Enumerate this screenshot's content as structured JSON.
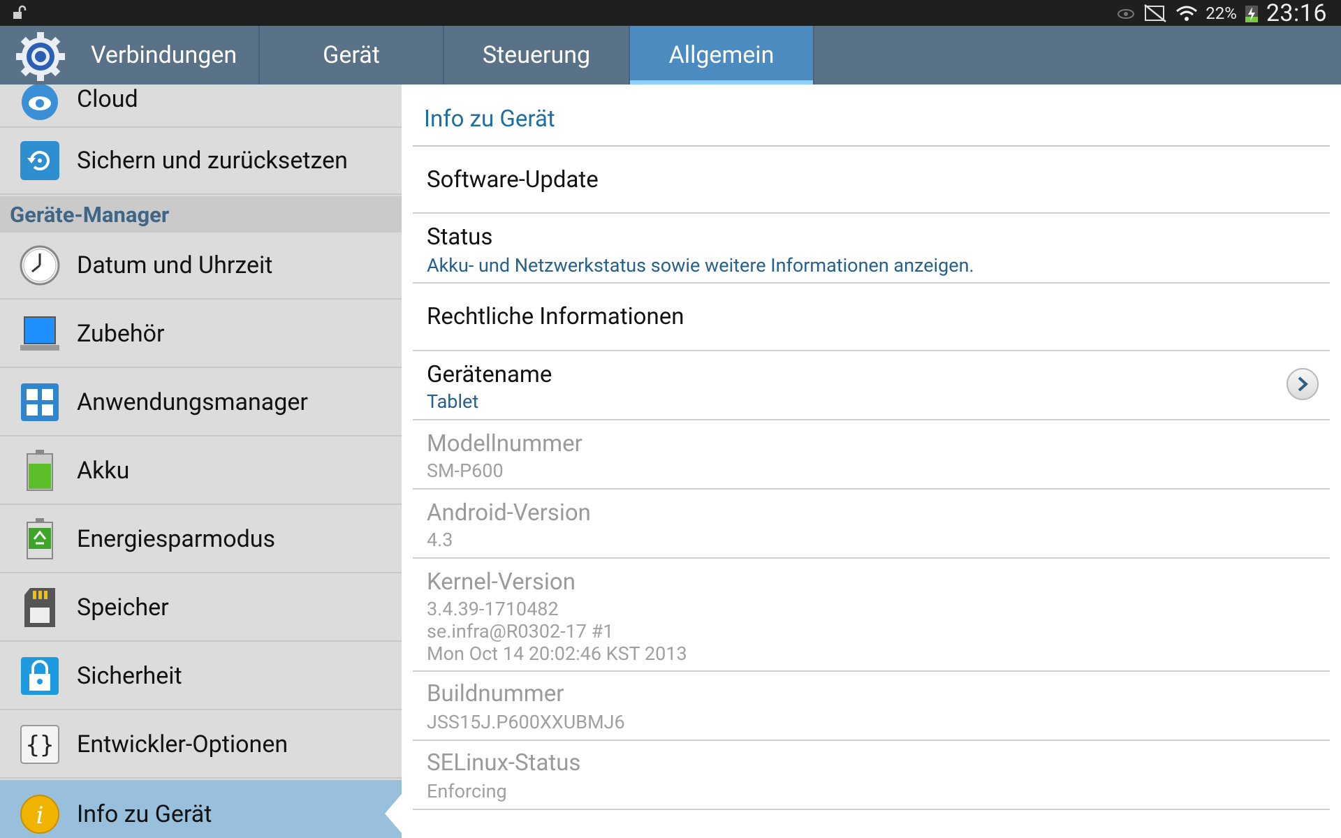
{
  "status_bar": {
    "battery_percent": "22%",
    "time": "23:16"
  },
  "tabs": [
    {
      "label": "Verbindungen"
    },
    {
      "label": "Gerät"
    },
    {
      "label": "Steuerung"
    },
    {
      "label": "Allgemein",
      "selected": true
    }
  ],
  "sidebar": {
    "items_top": [
      {
        "label": "Cloud",
        "icon": "cloud-icon"
      },
      {
        "label": "Sichern und zurücksetzen",
        "icon": "backup-reset-icon"
      }
    ],
    "section_header": "Geräte-Manager",
    "items": [
      {
        "label": "Datum und Uhrzeit",
        "icon": "clock-icon"
      },
      {
        "label": "Zubehör",
        "icon": "accessory-icon"
      },
      {
        "label": "Anwendungsmanager",
        "icon": "app-manager-icon"
      },
      {
        "label": "Akku",
        "icon": "battery-icon"
      },
      {
        "label": "Energiesparmodus",
        "icon": "power-saving-icon"
      },
      {
        "label": "Speicher",
        "icon": "storage-icon"
      },
      {
        "label": "Sicherheit",
        "icon": "security-lock-icon"
      },
      {
        "label": "Entwickler-Optionen",
        "icon": "developer-braces-icon"
      },
      {
        "label": "Info zu Gerät",
        "icon": "info-icon",
        "active": true
      }
    ]
  },
  "content": {
    "title": "Info zu Gerät",
    "rows": [
      {
        "title": "Software-Update"
      },
      {
        "title": "Status",
        "summary": "Akku- und Netzwerkstatus sowie weitere Informationen anzeigen."
      },
      {
        "title": "Rechtliche Informationen"
      },
      {
        "title": "Gerätename",
        "summary": "Tablet"
      },
      {
        "title": "Modellnummer",
        "summary": "SM-P600"
      },
      {
        "title": "Android-Version",
        "summary": "4.3"
      },
      {
        "title": "Kernel-Version",
        "summary_lines": [
          "3.4.39-1710482",
          "se.infra@R0302-17 #1",
          "Mon Oct 14 20:02:46 KST 2013"
        ]
      },
      {
        "title": "Buildnummer",
        "summary": "JSS15J.P600XXUBMJ6"
      },
      {
        "title": "SELinux-Status",
        "summary": "Enforcing"
      }
    ]
  },
  "colors": {
    "tabbar": "#5a7288",
    "tab_selected": "#4c8bbf",
    "section_header_text": "#3f6684",
    "title_accent": "#1e6f9f",
    "sidebar_active": "#98bfdc"
  }
}
